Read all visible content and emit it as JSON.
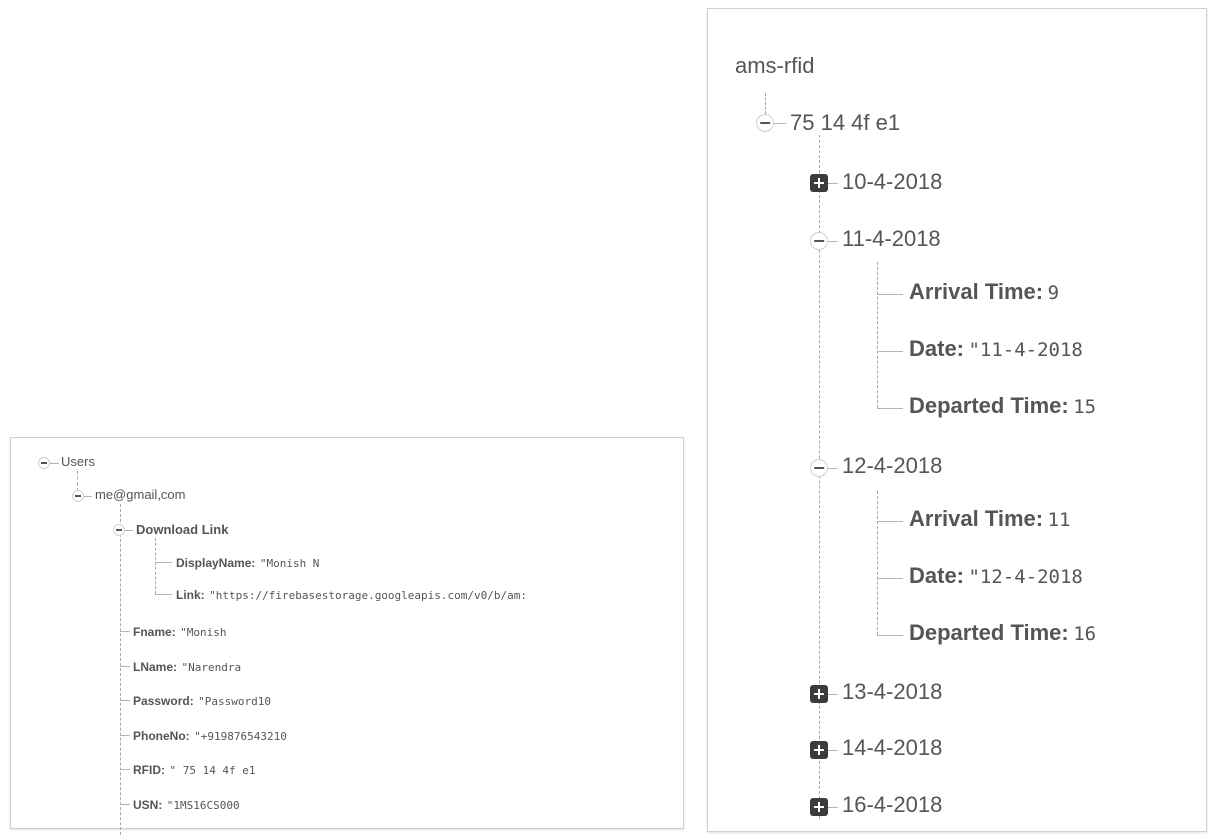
{
  "users_panel": {
    "root_label": "Users",
    "email_node": "me@gmail,com",
    "download_link": {
      "label": "Download Link",
      "display_name_key": "DisplayName:",
      "display_name_val": "\"Monish N",
      "link_key": "Link:",
      "link_val": "\"https://firebasestorage.googleapis.com/v0/b/am:"
    },
    "fields": [
      {
        "key": "Fname:",
        "value": "\"Monish"
      },
      {
        "key": "LName:",
        "value": "\"Narendra"
      },
      {
        "key": "Password:",
        "value": "\"Password10"
      },
      {
        "key": "PhoneNo:",
        "value": "\"+919876543210"
      },
      {
        "key": "RFID:",
        "value": "\" 75 14 4f e1"
      },
      {
        "key": "USN:",
        "value": "\"1MS16CS000"
      }
    ]
  },
  "ams_panel": {
    "title": "ams-rfid",
    "rfid_node": "75 14 4f e1",
    "dates": [
      {
        "label": "10-4-2018",
        "expanded": false
      },
      {
        "label": "11-4-2018",
        "expanded": true,
        "children": [
          {
            "key": "Arrival Time:",
            "value": "9"
          },
          {
            "key": "Date:",
            "value": "\"11-4-2018"
          },
          {
            "key": "Departed Time:",
            "value": "15"
          }
        ]
      },
      {
        "label": "12-4-2018",
        "expanded": true,
        "children": [
          {
            "key": "Arrival Time:",
            "value": "11"
          },
          {
            "key": "Date:",
            "value": "\"12-4-2018"
          },
          {
            "key": "Departed Time:",
            "value": "16"
          }
        ]
      },
      {
        "label": "13-4-2018",
        "expanded": false
      },
      {
        "label": "14-4-2018",
        "expanded": false
      },
      {
        "label": "16-4-2018",
        "expanded": false
      }
    ]
  }
}
